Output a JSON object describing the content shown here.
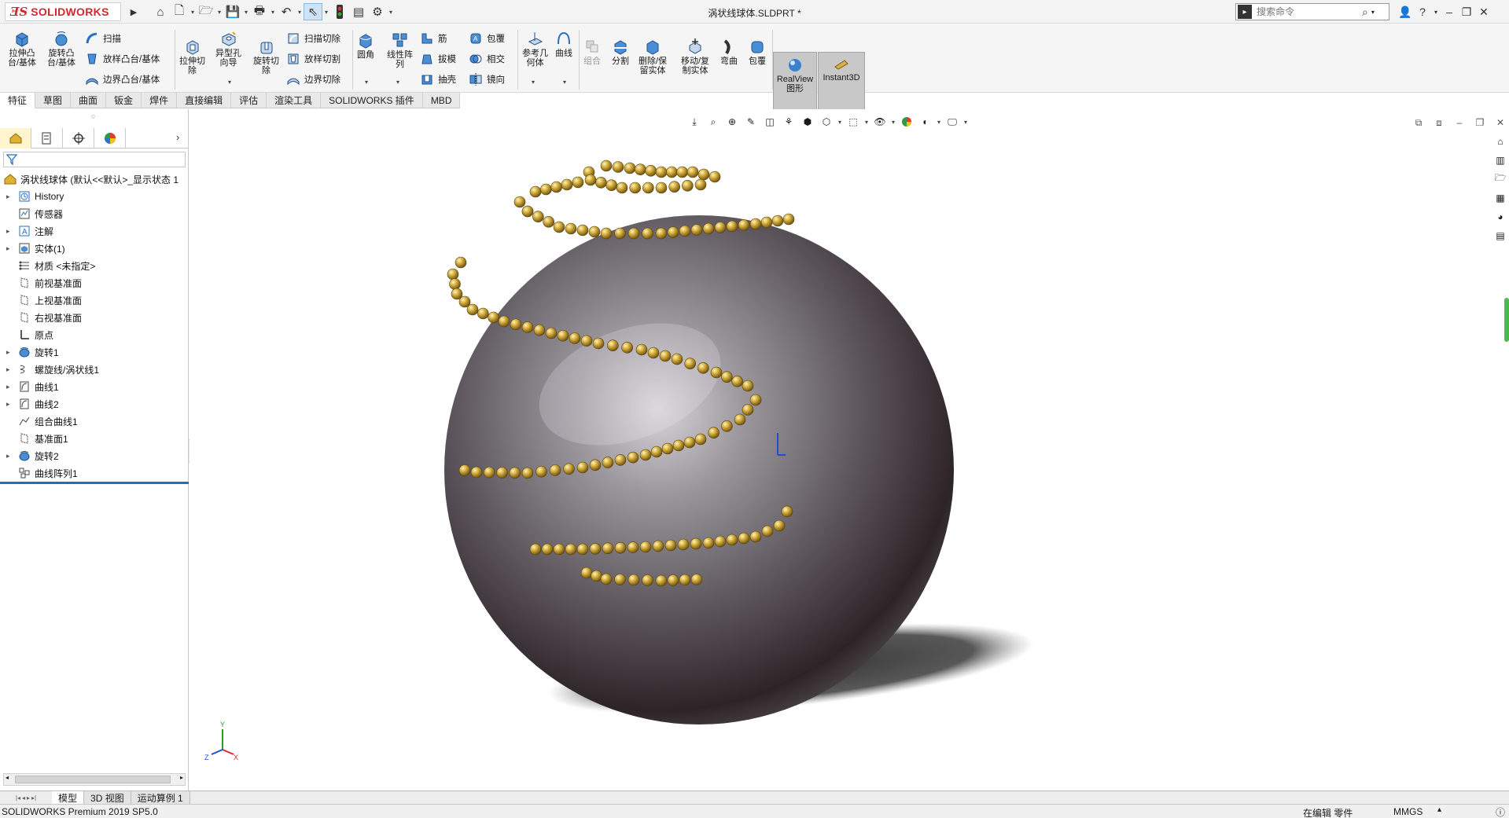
{
  "app": {
    "logo_text": "SOLIDWORKS",
    "document_title": "涡状线球体.SLDPRT *",
    "search_placeholder": "搜索命令"
  },
  "ribbon": {
    "extrude_boss": "拉伸凸\n台/基体",
    "revolve_boss": "旋转凸\n台/基体",
    "sweep": "扫描",
    "loft_boss": "放样凸台/基体",
    "boundary_boss": "边界凸台/基体",
    "extrude_cut": "拉伸切\n除",
    "hole_wizard": "异型孔\n向导",
    "revolve_cut": "旋转切\n除",
    "swept_cut": "扫描切除",
    "lofted_cut": "放样切割",
    "boundary_cut": "边界切除",
    "fillet": "圆角",
    "linear_pattern": "线性阵\n列",
    "rib": "筋",
    "draft": "拔模",
    "shell": "抽壳",
    "wrap": "包覆",
    "intersect": "相交",
    "mirror": "镜向",
    "reference_geometry": "参考几\n何体",
    "curves": "曲线",
    "combine": "组合",
    "split": "分割",
    "delete_keep_body": "删除/保\n留实体",
    "move_copy_body": "移动/复\n制实体",
    "flex": "弯曲",
    "wrap2": "包覆",
    "realview": "RealView\n图形",
    "instant3d": "Instant3D"
  },
  "command_tabs": [
    "特征",
    "草图",
    "曲面",
    "钣金",
    "焊件",
    "直接编辑",
    "评估",
    "渲染工具",
    "SOLIDWORKS 插件",
    "MBD"
  ],
  "tree": {
    "root": "涡状线球体  (默认<<默认>_显示状态 1",
    "items": [
      {
        "label": "History",
        "expandable": true,
        "icon": "history-icon"
      },
      {
        "label": "传感器",
        "expandable": false,
        "icon": "sensor-icon"
      },
      {
        "label": "注解",
        "expandable": true,
        "icon": "annotation-icon"
      },
      {
        "label": "实体(1)",
        "expandable": true,
        "icon": "solid-bodies-icon"
      },
      {
        "label": "材质 <未指定>",
        "expandable": false,
        "icon": "material-icon"
      },
      {
        "label": "前视基准面",
        "expandable": false,
        "icon": "plane-icon"
      },
      {
        "label": "上视基准面",
        "expandable": false,
        "icon": "plane-icon"
      },
      {
        "label": "右视基准面",
        "expandable": false,
        "icon": "plane-icon"
      },
      {
        "label": "原点",
        "expandable": false,
        "icon": "origin-icon"
      },
      {
        "label": "旋转1",
        "expandable": true,
        "icon": "revolve-icon"
      },
      {
        "label": "螺旋线/涡状线1",
        "expandable": true,
        "icon": "helix-icon"
      },
      {
        "label": "曲线1",
        "expandable": true,
        "icon": "curve-icon"
      },
      {
        "label": "曲线2",
        "expandable": true,
        "icon": "curve-icon"
      },
      {
        "label": "组合曲线1",
        "expandable": false,
        "icon": "composite-curve-icon"
      },
      {
        "label": "基准面1",
        "expandable": false,
        "icon": "plane-icon"
      },
      {
        "label": "旋转2",
        "expandable": true,
        "icon": "revolve-icon"
      },
      {
        "label": "曲线阵列1",
        "expandable": false,
        "icon": "curve-pattern-icon"
      }
    ]
  },
  "bottom_tabs": [
    "模型",
    "3D 视图",
    "运动算例 1"
  ],
  "status": {
    "product": "SOLIDWORKS Premium 2019 SP5.0",
    "mode": "在编辑 零件",
    "units": "MMGS"
  },
  "colors": {
    "brand": "#d5262e",
    "accent": "#1f6fc0",
    "bead_gold": "#c9a53a",
    "sphere_metal": "#7b767c"
  }
}
